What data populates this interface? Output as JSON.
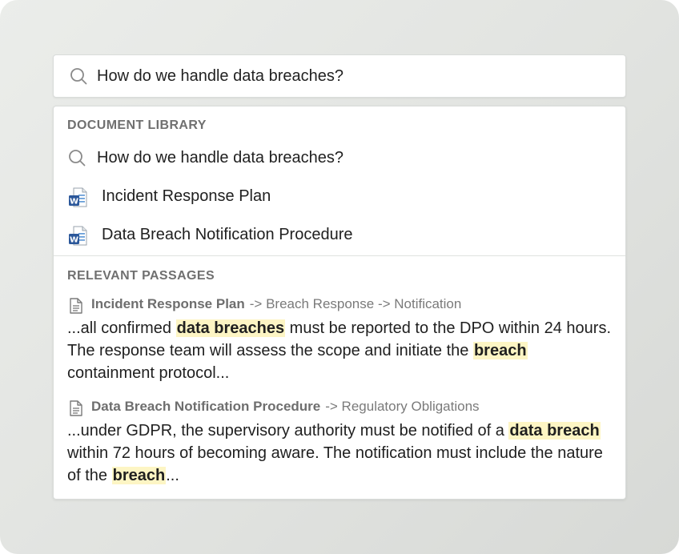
{
  "search": {
    "query": "How do we handle data breaches?",
    "icon": "search-icon"
  },
  "document_library": {
    "heading": "DOCUMENT LIBRARY",
    "items": [
      {
        "label": "How do we handle data breaches?",
        "icon": "search-icon"
      },
      {
        "label": "Incident Response Plan",
        "icon": "word-document-icon"
      },
      {
        "label": "Data Breach Notification Procedure",
        "icon": "word-document-icon"
      }
    ]
  },
  "relevant_passages": {
    "heading": "RELEVANT PASSAGES",
    "items": [
      {
        "document": "Incident Response Plan",
        "path": "-> Breach Response -> Notification",
        "icon": "document-icon",
        "segments": [
          {
            "text": "...all confirmed ",
            "highlight": false
          },
          {
            "text": "data breaches",
            "highlight": true
          },
          {
            "text": " must be reported to the DPO within 24 hours. The response team will assess the scope and initiate the ",
            "highlight": false
          },
          {
            "text": "breach",
            "highlight": true
          },
          {
            "text": " containment protocol...",
            "highlight": false
          }
        ]
      },
      {
        "document": "Data Breach Notification Procedure",
        "path": "-> Regulatory Obligations",
        "icon": "document-icon",
        "segments": [
          {
            "text": "...under GDPR, the supervisory authority must be notified of a ",
            "highlight": false
          },
          {
            "text": "data breach",
            "highlight": true
          },
          {
            "text": " within 72 hours of becoming aware. The notification must include the nature of the ",
            "highlight": false
          },
          {
            "text": "breach",
            "highlight": true
          },
          {
            "text": "...",
            "highlight": false
          }
        ]
      }
    ]
  },
  "colors": {
    "highlight": "#fdf5c4",
    "word_blue": "#2b579a"
  }
}
